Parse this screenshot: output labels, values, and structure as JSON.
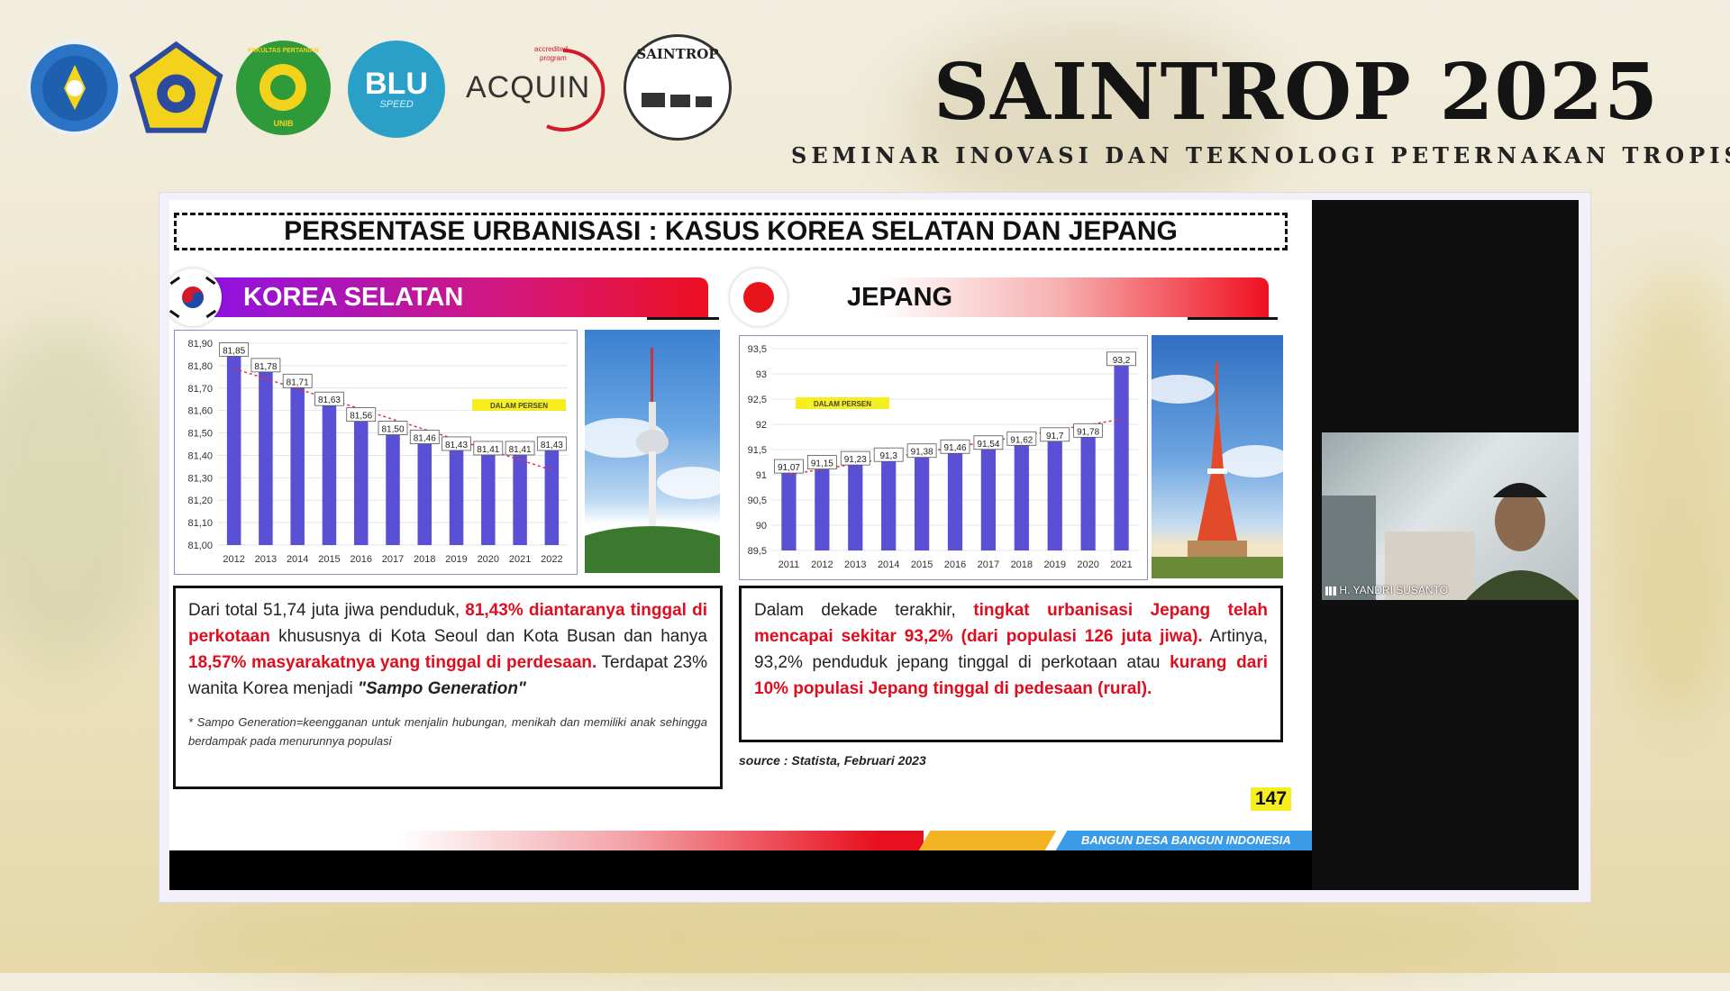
{
  "header": {
    "title": "SAINTROP 2025",
    "subtitle": "SEMINAR INOVASI DAN TEKNOLOGI PETERNAKAN TROPIS",
    "logos": {
      "unib_label": "FAKULTAS PERTANIAN",
      "unib_bottom": "UNIB",
      "blu_text": "BLU",
      "blu_sub": "SPEED",
      "acquin_text": "ACQUIN",
      "acquin_top": "accredited",
      "acquin_top2": "program",
      "saintrop_text": "SAINTROP"
    }
  },
  "slide": {
    "title": "PERSENTASE URBANISASI : KASUS KOREA SELATAN DAN JEPANG",
    "korea": {
      "name": "KOREA SELATAN",
      "badge": "DALAM PERSEN",
      "text_parts": [
        "Dari total 51,74 juta jiwa penduduk, ",
        "81,43% diantaranya tinggal di perkotaan",
        " khususnya di Kota Seoul dan Kota Busan dan hanya ",
        "18,57% masyarakatnya yang tinggal di perdesaan.",
        " Terdapat 23% wanita Korea menjadi ",
        "\"Sampo Generation\""
      ],
      "note": "* Sampo Generation=keengganan untuk menjalin hubungan, menikah dan memiliki anak sehingga berdampak pada menurunnya populasi"
    },
    "japan": {
      "name": "JEPANG",
      "badge": "DALAM PERSEN",
      "text_parts": [
        "Dalam dekade terakhir, ",
        "tingkat urbanisasi Jepang telah mencapai sekitar 93,2% (dari populasi 126 juta jiwa).",
        " Artinya, 93,2% penduduk jepang tinggal di perkotaan atau ",
        "kurang dari 10% populasi Jepang tinggal di pedesaan (rural)."
      ],
      "source": "source : Statista, Februari 2023"
    },
    "page_number": "147",
    "footer_text": "BANGUN DESA BANGUN INDONESIA"
  },
  "video": {
    "participant_name": "H. YANDRI SUSANTO"
  },
  "colors": {
    "bar": "#5a50d6",
    "trend": "#e0344a",
    "korea_bar_start": "#8a12e8",
    "korea_bar_end": "#ef1020",
    "japan_bar_start": "#ffffff",
    "japan_bar_end": "#ef1020",
    "red_text": "#e00d1f",
    "badge": "#f6ee1e"
  },
  "chart_data": [
    {
      "type": "bar",
      "categories": [
        "2012",
        "2013",
        "2014",
        "2015",
        "2016",
        "2017",
        "2018",
        "2019",
        "2020",
        "2021",
        "2022"
      ],
      "values": [
        81.85,
        81.78,
        81.71,
        81.63,
        81.56,
        81.5,
        81.46,
        81.43,
        81.41,
        81.41,
        81.43
      ],
      "value_labels": [
        "81,85",
        "81,78",
        "81,71",
        "81,63",
        "81,56",
        "81,50",
        "81,46",
        "81,43",
        "81,41",
        "81,41",
        "81,43"
      ],
      "ylim": [
        81.0,
        81.9
      ],
      "yticks": [
        "81,90",
        "81,80",
        "81,70",
        "81,60",
        "81,50",
        "81,40",
        "81,30",
        "81,20",
        "81,10",
        "81,00"
      ],
      "trendline": true,
      "legend_badge": "DALAM PERSEN"
    },
    {
      "type": "bar",
      "categories": [
        "2011",
        "2012",
        "2013",
        "2014",
        "2015",
        "2016",
        "2017",
        "2018",
        "2019",
        "2020",
        "2021"
      ],
      "values": [
        91.07,
        91.15,
        91.23,
        91.3,
        91.38,
        91.46,
        91.54,
        91.62,
        91.7,
        91.78,
        93.2
      ],
      "value_labels": [
        "91,07",
        "91,15",
        "91,23",
        "91,3",
        "91,38",
        "91,46",
        "91,54",
        "91,62",
        "91,7",
        "91,78",
        "93,2"
      ],
      "ylim": [
        89.5,
        93.5
      ],
      "yticks": [
        "93,5",
        "93",
        "92,5",
        "92",
        "91,5",
        "91",
        "90,5",
        "90",
        "89,5"
      ],
      "trendline": true,
      "legend_badge": "DALAM PERSEN"
    }
  ]
}
